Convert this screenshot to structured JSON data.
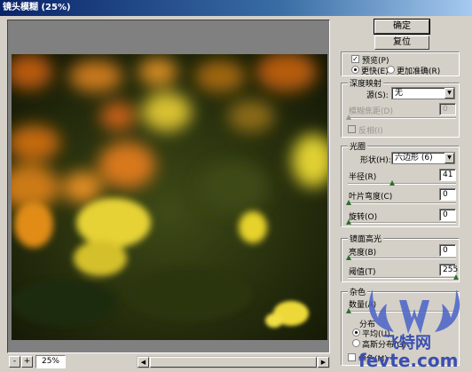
{
  "window": {
    "title": "镜头模糊 (25%)"
  },
  "buttons": {
    "ok": "确定",
    "reset": "复位"
  },
  "preview": {
    "checkbox_label": "预览(P)",
    "checked": true,
    "mode_faster": "更快(E)",
    "mode_accurate": "更加准确(R)",
    "selected_mode": "faster"
  },
  "depth_map": {
    "title": "深度映射",
    "source_label": "源(S):",
    "source_value": "无",
    "blur_focal_label": "模糊焦距(D)",
    "blur_focal_value": "0",
    "invert_label": "反相(I)"
  },
  "iris": {
    "title": "光圈",
    "shape_label": "形状(H):",
    "shape_value": "六边形 (6)",
    "radius_label": "半径(R)",
    "radius_value": "41",
    "blade_curvature_label": "叶片弯度(C)",
    "blade_curvature_value": "0",
    "rotation_label": "旋转(O)",
    "rotation_value": "0"
  },
  "specular": {
    "title": "镜面高光",
    "brightness_label": "亮度(B)",
    "brightness_value": "0",
    "threshold_label": "阈值(T)",
    "threshold_value": "255"
  },
  "noise": {
    "title": "杂色",
    "amount_label": "数量(A)",
    "distribution_title": "分布",
    "uniform": "平均(U)",
    "gaussian": "高斯分布(G)",
    "mono_label": "单色(M)"
  },
  "zoom": {
    "minus": "-",
    "plus": "+",
    "value": "25%"
  },
  "watermark": {
    "brand_cn": "飞特网",
    "domain": "fevte.com"
  },
  "icons": {
    "zoom_out": "minus-icon",
    "zoom_in": "plus-icon",
    "scroll_left": "arrow-left-icon",
    "scroll_right": "arrow-right-icon",
    "dropdown": "chevron-down-icon",
    "slider_knob": "triangle-up-icon"
  },
  "colors": {
    "titlebar": "#0a246a",
    "slider_knob": "#2b6f2b",
    "watermark": "#3b4fb0"
  }
}
